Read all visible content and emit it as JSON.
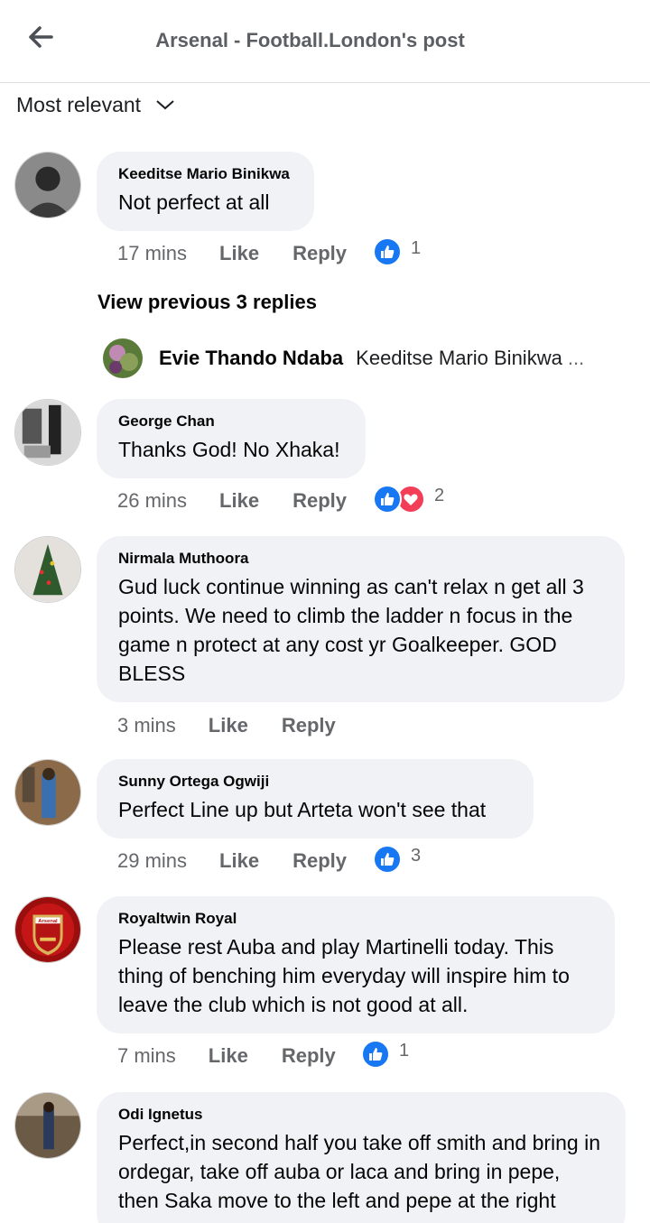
{
  "header": {
    "title": "Arsenal - Football.London's post",
    "back_icon": "back-arrow-icon"
  },
  "sort": {
    "label": "Most relevant",
    "icon": "chevron-down-icon"
  },
  "actions": {
    "like_label": "Like",
    "reply_label": "Reply"
  },
  "colors": {
    "like_blue": "#1877f2",
    "love_red": "#f33e58",
    "bubble_bg": "#f0f2f5",
    "meta_gray": "#65676b"
  },
  "comments": [
    {
      "name": "Keeditse Mario Binikwa",
      "text": "Not perfect at all",
      "time": "17 mins",
      "reactions": [
        "like"
      ],
      "reaction_count": "1"
    },
    {
      "name": "George Chan",
      "text": "Thanks God! No Xhaka!",
      "time": "26 mins",
      "reactions": [
        "like",
        "love"
      ],
      "reaction_count": "2"
    },
    {
      "name": "Nirmala Muthoora",
      "text": "Gud luck continue winning as can't relax n get all 3 points. We need to climb the ladder n focus  in the game n protect at any cost yr Goalkeeper. GOD BLESS",
      "time": "3 mins"
    },
    {
      "name": "Sunny Ortega Ogwiji",
      "text": "Perfect Line up but Arteta won't see that",
      "time": "29 mins",
      "reactions": [
        "like"
      ],
      "reaction_count": "3"
    },
    {
      "name": "Royaltwin Royal",
      "text": "Please rest Auba and play Martinelli today. This thing of benching him everyday will inspire him to leave the club which is not good at all.",
      "time": "7 mins",
      "reactions": [
        "like"
      ],
      "reaction_count": "1",
      "avatar_badge": "Arsenal"
    },
    {
      "name": "Odi Ignetus",
      "text": "Perfect,in second half you take off smith and bring in ordegar, take off auba or laca and bring in pepe, then Saka move to the left and pepe at the right"
    }
  ],
  "view_previous": "View previous 3 replies",
  "reply_preview": {
    "name": "Evie Thando Ndaba",
    "text": "Keeditse Mario Binikwa",
    "ellipsis": "..."
  }
}
